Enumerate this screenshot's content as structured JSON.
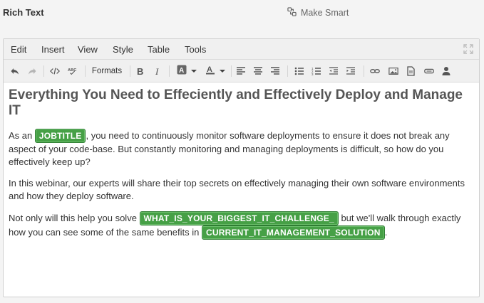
{
  "header": {
    "title": "Rich Text",
    "make_smart_label": "Make Smart"
  },
  "menubar": {
    "items": [
      "Edit",
      "Insert",
      "View",
      "Style",
      "Table",
      "Tools"
    ]
  },
  "toolbar": {
    "formats_label": "Formats"
  },
  "content": {
    "heading": "Everything You Need to Effeciently and Effectively Deploy and Manage IT",
    "p1_before": "As an ",
    "p1_tag": "JOBTITLE",
    "p1_after": ", you need to continuously monitor software deployments to ensure it does not break any aspect of your code-base. But constantly monitoring and managing deployments is difficult, so how do you effectively keep up?",
    "p2": "In this webinar, our experts will share their top secrets on effectively managing their own software environments and how they deploy software.",
    "p3_before": "Not only will this help you solve ",
    "p3_tag1": "WHAT_IS_YOUR_BIGGEST_IT_CHALLENGE_",
    "p3_middle": " but we'll walk through exactly how you can see some of the same benefits in ",
    "p3_tag2": "CURRENT_IT_MANAGEMENT_SOLUTION",
    "p3_after": "."
  },
  "colors": {
    "tag_bg": "#46a046",
    "tag_text": "#ffffff"
  }
}
